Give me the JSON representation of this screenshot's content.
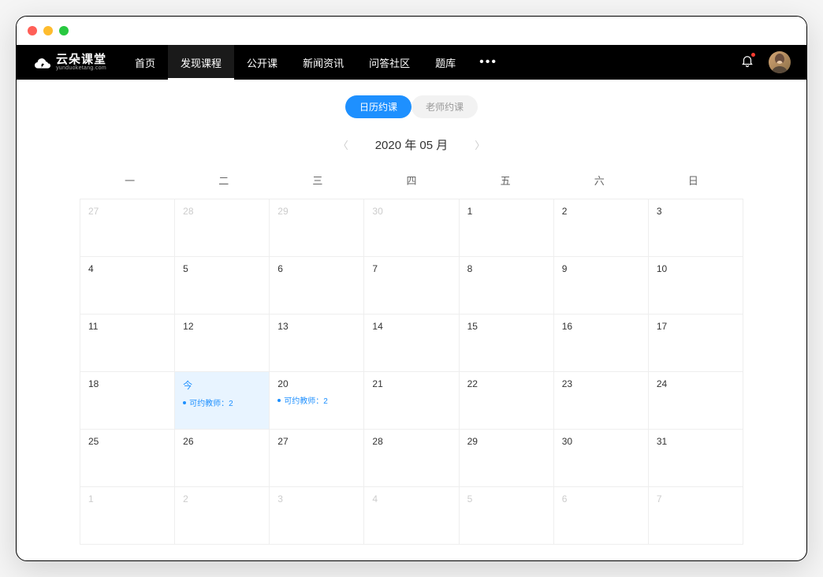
{
  "logo": {
    "main": "云朵课堂",
    "sub": "yunduoketang.com"
  },
  "nav": {
    "items": [
      "首页",
      "发现课程",
      "公开课",
      "新闻资讯",
      "问答社区",
      "题库"
    ],
    "activeIndex": 1
  },
  "tabs": {
    "calendar": "日历约课",
    "teacher": "老师约课"
  },
  "month": {
    "label": "2020 年 05 月"
  },
  "weekdays": [
    "一",
    "二",
    "三",
    "四",
    "五",
    "六",
    "日"
  ],
  "teacherTag": "可约教师：2",
  "todayLabel": "今",
  "cells": [
    {
      "n": "27",
      "dim": true
    },
    {
      "n": "28",
      "dim": true
    },
    {
      "n": "29",
      "dim": true
    },
    {
      "n": "30",
      "dim": true
    },
    {
      "n": "1"
    },
    {
      "n": "2"
    },
    {
      "n": "3"
    },
    {
      "n": "4"
    },
    {
      "n": "5"
    },
    {
      "n": "6"
    },
    {
      "n": "7"
    },
    {
      "n": "8"
    },
    {
      "n": "9"
    },
    {
      "n": "10"
    },
    {
      "n": "11"
    },
    {
      "n": "12"
    },
    {
      "n": "13"
    },
    {
      "n": "14"
    },
    {
      "n": "15"
    },
    {
      "n": "16"
    },
    {
      "n": "17"
    },
    {
      "n": "18"
    },
    {
      "n": "今",
      "today": true,
      "tag": true
    },
    {
      "n": "20",
      "tag": true
    },
    {
      "n": "21"
    },
    {
      "n": "22"
    },
    {
      "n": "23"
    },
    {
      "n": "24"
    },
    {
      "n": "25"
    },
    {
      "n": "26"
    },
    {
      "n": "27"
    },
    {
      "n": "28"
    },
    {
      "n": "29"
    },
    {
      "n": "30"
    },
    {
      "n": "31"
    },
    {
      "n": "1",
      "dim": true
    },
    {
      "n": "2",
      "dim": true
    },
    {
      "n": "3",
      "dim": true
    },
    {
      "n": "4",
      "dim": true
    },
    {
      "n": "5",
      "dim": true
    },
    {
      "n": "6",
      "dim": true
    },
    {
      "n": "7",
      "dim": true
    }
  ]
}
